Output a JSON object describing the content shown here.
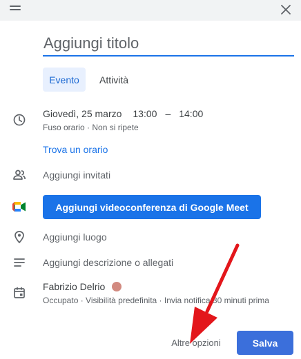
{
  "header": {
    "drag_icon": "drag-handle-icon",
    "close_icon": "close-icon"
  },
  "title": {
    "placeholder": "Aggiungi titolo",
    "value": ""
  },
  "type_tabs": [
    {
      "label": "Evento",
      "selected": true
    },
    {
      "label": "Attività",
      "selected": false
    }
  ],
  "schedule": {
    "date": "Giovedì, 25 marzo",
    "start": "13:00",
    "separator": "–",
    "end": "14:00",
    "meta": "Fuso orario · Non si ripete",
    "find_time_link": "Trova un orario"
  },
  "guests": {
    "label": "Aggiungi invitati"
  },
  "meet": {
    "button_label": "Aggiungi videoconferenza di Google Meet"
  },
  "location": {
    "label": "Aggiungi luogo"
  },
  "description": {
    "label": "Aggiungi descrizione o allegati"
  },
  "calendar": {
    "owner": "Fabrizio Delrio",
    "color": "#d28a80",
    "meta": "Occupato · Visibilità predefinita · Invia notifica 30 minuti prima"
  },
  "footer": {
    "more_options_label": "Altre opzioni",
    "save_label": "Salva"
  },
  "annotation": {
    "arrow_color": "#e3161b"
  },
  "colors": {
    "accent": "#1a73e8",
    "save_button": "#3b6fdb",
    "tab_selected_bg": "#e8f0fe"
  }
}
